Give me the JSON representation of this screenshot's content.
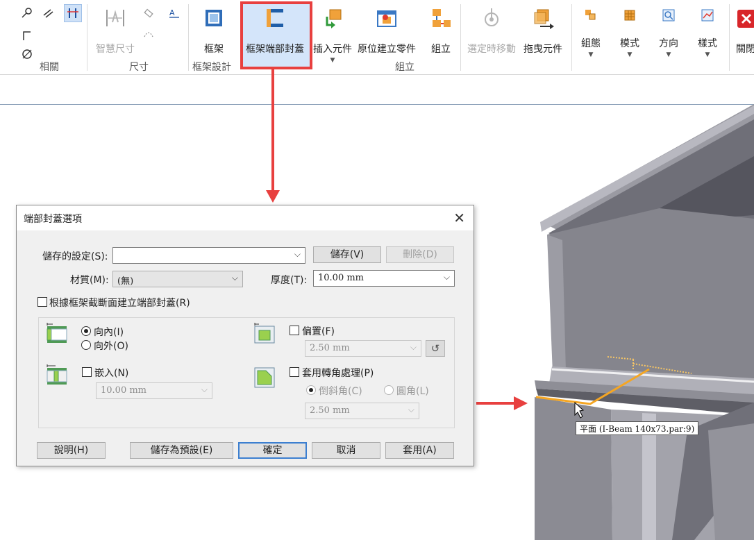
{
  "ribbon": {
    "groups": {
      "relations": "相關",
      "dimensions": "尺寸",
      "frame_design": "框架設計",
      "assembly": "組立"
    },
    "buttons": {
      "smart_dimension": "智慧尺寸",
      "frame": "框架",
      "frame_end_cap": "框架端部封蓋",
      "insert_component": "插入元件",
      "create_in_place": "原位建立零件",
      "assemble": "組立",
      "move_while_select": "選定時移動",
      "drag_component": "拖曳元件",
      "configurations": "組態",
      "pattern": "模式",
      "orientation": "方向",
      "style": "樣式",
      "close": "關閉"
    }
  },
  "dialog": {
    "title": "端部封蓋選項",
    "saved_settings_label": "儲存的設定(S):",
    "saved_settings_value": "",
    "save_button": "儲存(V)",
    "delete_button": "刪除(D)",
    "material_label": "材質(M):",
    "material_value": "(無)",
    "thickness_label": "厚度(T):",
    "thickness_value": "10.00 mm",
    "create_from_section_label": "根據框架截斷面建立端部封蓋(R)",
    "inward_label": "向內(I)",
    "outward_label": "向外(O)",
    "inset_label": "嵌入(N)",
    "inset_value": "10.00 mm",
    "offset_label": "偏置(F)",
    "offset_value": "2.50 mm",
    "corner_treatment_label": "套用轉角處理(P)",
    "chamfer_label": "倒斜角(C)",
    "round_label": "圓角(L)",
    "corner_value": "2.50 mm",
    "help_button": "說明(H)",
    "save_default_button": "儲存為預設(E)",
    "ok_button": "確定",
    "cancel_button": "取消",
    "apply_button": "套用(A)"
  },
  "model": {
    "tooltip": "平面 (I-Beam 140x73.par:9)"
  },
  "colors": {
    "highlight": "#e8403f",
    "ribbon_selected": "#b0cff5",
    "beam_face": "#8d8d94",
    "edge_highlight": "#f5a623"
  }
}
